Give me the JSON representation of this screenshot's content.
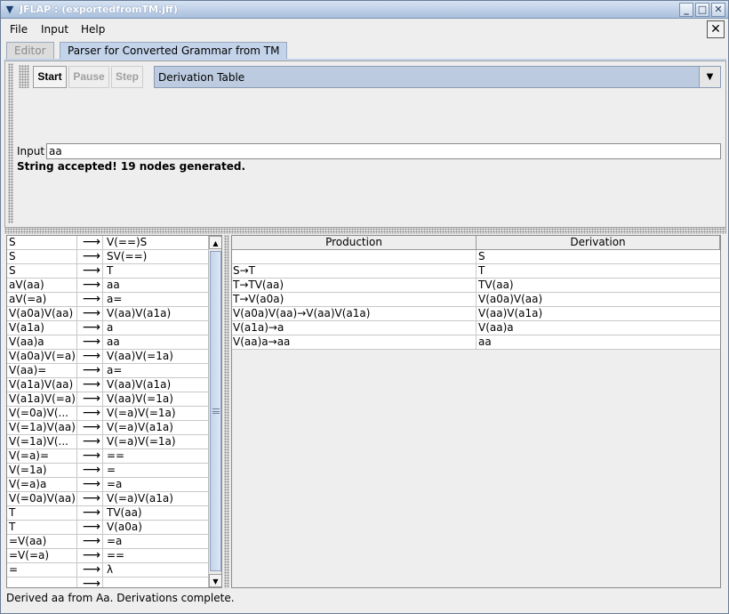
{
  "window": {
    "title": "JFLAP : (exportedfromTM.jff)"
  },
  "menu": {
    "items": [
      "File",
      "Input",
      "Help"
    ]
  },
  "tabs": {
    "editor": "Editor",
    "parser": "Parser for Converted Grammar from TM"
  },
  "toolbar": {
    "start": "Start",
    "pause": "Pause",
    "step": "Step",
    "view_selected": "Derivation Table"
  },
  "input": {
    "label": "Input",
    "value": "aa"
  },
  "parse_status": "String accepted!  19 nodes generated.",
  "grammar": {
    "arrow": "⟶",
    "rows": [
      {
        "lhs": "S",
        "rhs": "V(==)S"
      },
      {
        "lhs": "S",
        "rhs": "SV(==)"
      },
      {
        "lhs": "S",
        "rhs": "T"
      },
      {
        "lhs": "aV(aa)",
        "rhs": "aa"
      },
      {
        "lhs": "aV(=a)",
        "rhs": "a="
      },
      {
        "lhs": "V(a0a)V(aa)",
        "rhs": "V(aa)V(a1a)"
      },
      {
        "lhs": "V(a1a)",
        "rhs": "a"
      },
      {
        "lhs": "V(aa)a",
        "rhs": "aa"
      },
      {
        "lhs": "V(a0a)V(=a)",
        "rhs": "V(aa)V(=1a)"
      },
      {
        "lhs": "V(aa)=",
        "rhs": "a="
      },
      {
        "lhs": "V(a1a)V(aa)",
        "rhs": "V(aa)V(a1a)"
      },
      {
        "lhs": "V(a1a)V(=a)",
        "rhs": "V(aa)V(=1a)"
      },
      {
        "lhs": "V(=0a)V(...",
        "rhs": "V(=a)V(=1a)"
      },
      {
        "lhs": "V(=1a)V(aa)",
        "rhs": "V(=a)V(a1a)"
      },
      {
        "lhs": "V(=1a)V(...",
        "rhs": "V(=a)V(=1a)"
      },
      {
        "lhs": "V(=a)=",
        "rhs": "=="
      },
      {
        "lhs": "V(=1a)",
        "rhs": "="
      },
      {
        "lhs": "V(=a)a",
        "rhs": "=a"
      },
      {
        "lhs": "V(=0a)V(aa)",
        "rhs": "V(=a)V(a1a)"
      },
      {
        "lhs": "T",
        "rhs": "TV(aa)"
      },
      {
        "lhs": "T",
        "rhs": "V(a0a)"
      },
      {
        "lhs": "=V(aa)",
        "rhs": "=a"
      },
      {
        "lhs": "=V(=a)",
        "rhs": "=="
      },
      {
        "lhs": "=",
        "rhs": "λ"
      },
      {
        "lhs": "",
        "rhs": ""
      }
    ]
  },
  "derivation_table": {
    "headers": [
      "Production",
      "Derivation"
    ],
    "rows": [
      {
        "production": "",
        "derivation": "S"
      },
      {
        "production": "S→T",
        "derivation": "T"
      },
      {
        "production": "T→TV(aa)",
        "derivation": "TV(aa)"
      },
      {
        "production": "T→V(a0a)",
        "derivation": "V(a0a)V(aa)"
      },
      {
        "production": "V(a0a)V(aa)→V(aa)V(a1a)",
        "derivation": "V(aa)V(a1a)"
      },
      {
        "production": "V(a1a)→a",
        "derivation": "V(aa)a"
      },
      {
        "production": "V(aa)a→aa",
        "derivation": "aa"
      }
    ]
  },
  "status_bar": "Derived aa from Aa.  Derivations complete."
}
